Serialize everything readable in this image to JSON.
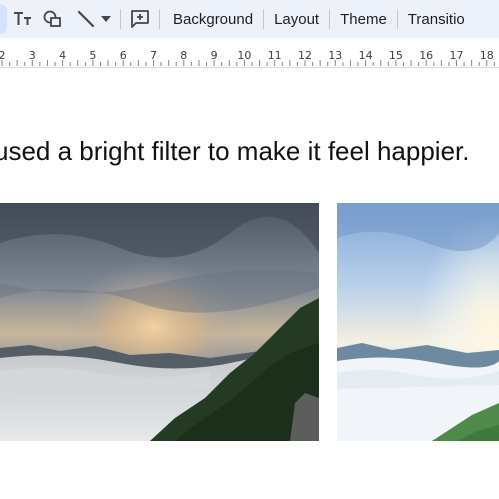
{
  "toolbar": {
    "items": [
      {
        "label": "Background"
      },
      {
        "label": "Layout"
      },
      {
        "label": "Theme"
      },
      {
        "label": "Transitio"
      }
    ],
    "icons": [
      "text-format-icon",
      "shapes-icon",
      "line-icon",
      "chevron-down-icon",
      "insert-comment-icon"
    ]
  },
  "ruler": {
    "labels": [
      "2",
      "3",
      "4",
      "5",
      "6",
      "7",
      "8",
      "9",
      "10",
      "11",
      "12",
      "13",
      "14",
      "15",
      "16",
      "17",
      "18"
    ]
  },
  "slide": {
    "caption": "used a bright filter to make it feel happier."
  },
  "colors": {
    "toolbar_bg": "#edf2fa",
    "selection": "#d3e3fd",
    "icon": "#444746"
  }
}
